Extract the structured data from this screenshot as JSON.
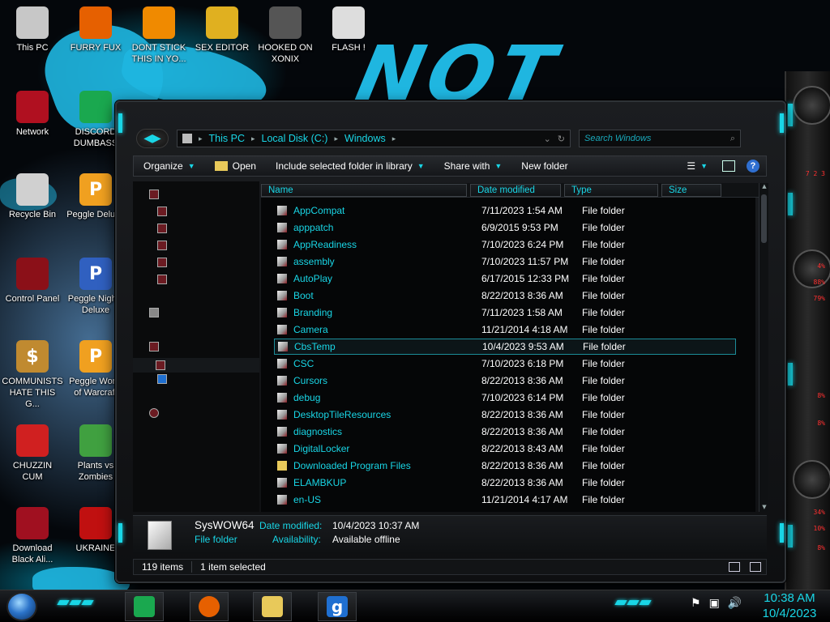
{
  "desktop": {
    "icons": [
      {
        "label": "This PC",
        "color": "#c7c7c7",
        "glyph": ""
      },
      {
        "label": "FURRY FUX",
        "color": "#e66000",
        "glyph": ""
      },
      {
        "label": "DONT STICK THIS IN YO...",
        "color": "#f08a00",
        "glyph": ""
      },
      {
        "label": "SEX EDITOR",
        "color": "#e0b020",
        "glyph": ""
      },
      {
        "label": "HOOKED ON XONIX",
        "color": "#555555",
        "glyph": ""
      },
      {
        "label": "FLASH !",
        "color": "#dddddd",
        "glyph": ""
      },
      {
        "label": "Network",
        "color": "#b01020",
        "glyph": ""
      },
      {
        "label": "DISCORD DUMBASS",
        "color": "#1aa84f",
        "glyph": ""
      },
      {
        "label": "Recycle Bin",
        "color": "#d0d0d0",
        "glyph": ""
      },
      {
        "label": "Peggle Deluxe",
        "color": "#f0a020",
        "glyph": "P"
      },
      {
        "label": "Control Panel",
        "color": "#8b1018",
        "glyph": ""
      },
      {
        "label": "Peggle Nights Deluxe",
        "color": "#3060c0",
        "glyph": "P"
      },
      {
        "label": "COMMUNISTS HATE THIS G...",
        "color": "#c08a30",
        "glyph": "$"
      },
      {
        "label": "Peggle World of Warcraft",
        "color": "#f0a020",
        "glyph": "P"
      },
      {
        "label": "CHUZZIN CUM",
        "color": "#d02020",
        "glyph": ""
      },
      {
        "label": "Plants vs Zombies",
        "color": "#40a040",
        "glyph": ""
      },
      {
        "label": "Download Black Ali...",
        "color": "#a01020",
        "glyph": ""
      },
      {
        "label": "UKRAINE",
        "color": "#c01010",
        "glyph": ""
      }
    ]
  },
  "wallpaper": {
    "text": "NOT REACT",
    "accent": "#1fb6e0"
  },
  "gadget": {
    "stats": [
      "4%",
      "88%",
      "79%",
      "8%",
      "8%",
      "34%",
      "10%",
      "8%"
    ],
    "title": "7 2 3"
  },
  "explorer": {
    "address": {
      "crumbs": [
        "This PC",
        "Local Disk (C:)",
        "Windows"
      ],
      "separator": "▸",
      "dropdown": "⌄",
      "refresh": "↻"
    },
    "search": {
      "placeholder": "Search Windows"
    },
    "toolbar": {
      "organize": "Organize",
      "open": "Open",
      "include": "Include selected folder in library",
      "share": "Share with",
      "new_folder": "New folder",
      "help": "?"
    },
    "columns": {
      "name": "Name",
      "date": "Date modified",
      "type": "Type",
      "size": "Size"
    },
    "files": [
      {
        "name": "AppCompat",
        "date": "7/11/2023 1:54 AM",
        "type": "File folder"
      },
      {
        "name": "apppatch",
        "date": "6/9/2015 9:53 PM",
        "type": "File folder"
      },
      {
        "name": "AppReadiness",
        "date": "7/10/2023 6:24 PM",
        "type": "File folder"
      },
      {
        "name": "assembly",
        "date": "7/10/2023 11:57 PM",
        "type": "File folder"
      },
      {
        "name": "AutoPlay",
        "date": "6/17/2015 12:33 PM",
        "type": "File folder"
      },
      {
        "name": "Boot",
        "date": "8/22/2013 8:36 AM",
        "type": "File folder"
      },
      {
        "name": "Branding",
        "date": "7/11/2023 1:58 AM",
        "type": "File folder"
      },
      {
        "name": "Camera",
        "date": "11/21/2014 4:18 AM",
        "type": "File folder"
      },
      {
        "name": "CbsTemp",
        "date": "10/4/2023 9:53 AM",
        "type": "File folder"
      },
      {
        "name": "CSC",
        "date": "7/10/2023 6:18 PM",
        "type": "File folder"
      },
      {
        "name": "Cursors",
        "date": "8/22/2013 8:36 AM",
        "type": "File folder"
      },
      {
        "name": "debug",
        "date": "7/10/2023 6:14 PM",
        "type": "File folder"
      },
      {
        "name": "DesktopTileResources",
        "date": "8/22/2013 8:36 AM",
        "type": "File folder"
      },
      {
        "name": "diagnostics",
        "date": "8/22/2013 8:36 AM",
        "type": "File folder"
      },
      {
        "name": "DigitalLocker",
        "date": "8/22/2013 8:43 AM",
        "type": "File folder"
      },
      {
        "name": "Downloaded Program Files",
        "date": "8/22/2013 8:36 AM",
        "type": "File folder"
      },
      {
        "name": "ELAMBKUP",
        "date": "8/22/2013 8:36 AM",
        "type": "File folder"
      },
      {
        "name": "en-US",
        "date": "11/21/2014 4:17 AM",
        "type": "File folder"
      }
    ],
    "details": {
      "name": "SysWOW64",
      "type": "File folder",
      "date_label": "Date modified:",
      "date_value": "10/4/2023 10:37 AM",
      "avail_label": "Availability:",
      "avail_value": "Available offline"
    },
    "status": {
      "items": "119 items",
      "selected": "1 item selected"
    }
  },
  "taskbar": {
    "clock_time": "10:38 AM",
    "clock_date": "10/4/2023",
    "pinned": [
      {
        "name": "discord",
        "color": "#1aa84f",
        "glyph": ""
      },
      {
        "name": "firefox",
        "color": "#e66000",
        "glyph": ""
      },
      {
        "name": "file-explorer",
        "color": "#e8c95a",
        "glyph": ""
      },
      {
        "name": "garrysmod",
        "color": "#1f6fd0",
        "glyph": "g"
      }
    ],
    "tray": [
      "⚑",
      "▣",
      "🔊"
    ]
  }
}
